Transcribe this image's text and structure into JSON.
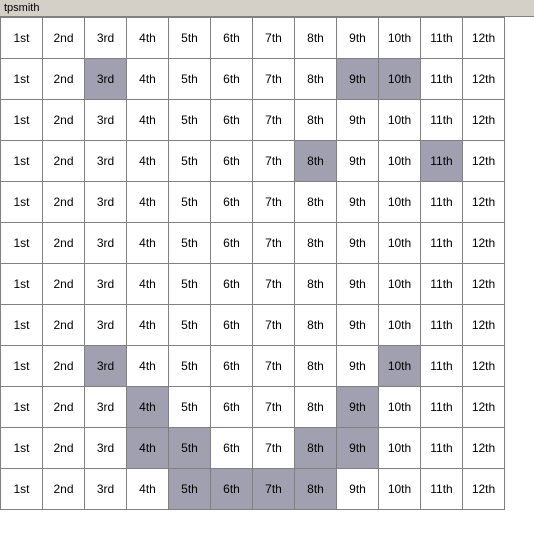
{
  "title": "tpsmith",
  "columns": [
    "1st",
    "2nd",
    "3rd",
    "4th",
    "5th",
    "6th",
    "7th",
    "8th",
    "9th",
    "10th",
    "11th",
    "12th"
  ],
  "rows": [
    {
      "cells": [
        {
          "text": "1st",
          "hl": false
        },
        {
          "text": "2nd",
          "hl": false
        },
        {
          "text": "3rd",
          "hl": false
        },
        {
          "text": "4th",
          "hl": false
        },
        {
          "text": "5th",
          "hl": false
        },
        {
          "text": "6th",
          "hl": false
        },
        {
          "text": "7th",
          "hl": false
        },
        {
          "text": "8th",
          "hl": false
        },
        {
          "text": "9th",
          "hl": false
        },
        {
          "text": "10th",
          "hl": false
        },
        {
          "text": "11th",
          "hl": false
        },
        {
          "text": "12th",
          "hl": false
        }
      ]
    },
    {
      "cells": [
        {
          "text": "1st",
          "hl": false
        },
        {
          "text": "2nd",
          "hl": false
        },
        {
          "text": "3rd",
          "hl": true
        },
        {
          "text": "4th",
          "hl": false
        },
        {
          "text": "5th",
          "hl": false
        },
        {
          "text": "6th",
          "hl": false
        },
        {
          "text": "7th",
          "hl": false
        },
        {
          "text": "8th",
          "hl": false
        },
        {
          "text": "9th",
          "hl": true
        },
        {
          "text": "10th",
          "hl": true
        },
        {
          "text": "11th",
          "hl": false
        },
        {
          "text": "12th",
          "hl": false
        }
      ]
    },
    {
      "cells": [
        {
          "text": "1st",
          "hl": false
        },
        {
          "text": "2nd",
          "hl": false
        },
        {
          "text": "3rd",
          "hl": false
        },
        {
          "text": "4th",
          "hl": false
        },
        {
          "text": "5th",
          "hl": false
        },
        {
          "text": "6th",
          "hl": false
        },
        {
          "text": "7th",
          "hl": false
        },
        {
          "text": "8th",
          "hl": false
        },
        {
          "text": "9th",
          "hl": false
        },
        {
          "text": "10th",
          "hl": false
        },
        {
          "text": "11th",
          "hl": false
        },
        {
          "text": "12th",
          "hl": false
        }
      ]
    },
    {
      "cells": [
        {
          "text": "1st",
          "hl": false
        },
        {
          "text": "2nd",
          "hl": false
        },
        {
          "text": "3rd",
          "hl": false
        },
        {
          "text": "4th",
          "hl": false
        },
        {
          "text": "5th",
          "hl": false
        },
        {
          "text": "6th",
          "hl": false
        },
        {
          "text": "7th",
          "hl": false
        },
        {
          "text": "8th",
          "hl": true
        },
        {
          "text": "9th",
          "hl": false
        },
        {
          "text": "10th",
          "hl": false
        },
        {
          "text": "11th",
          "hl": true
        },
        {
          "text": "12th",
          "hl": false
        }
      ]
    },
    {
      "cells": [
        {
          "text": "1st",
          "hl": false
        },
        {
          "text": "2nd",
          "hl": false
        },
        {
          "text": "3rd",
          "hl": false
        },
        {
          "text": "4th",
          "hl": false
        },
        {
          "text": "5th",
          "hl": false
        },
        {
          "text": "6th",
          "hl": false
        },
        {
          "text": "7th",
          "hl": false
        },
        {
          "text": "8th",
          "hl": false
        },
        {
          "text": "9th",
          "hl": false
        },
        {
          "text": "10th",
          "hl": false
        },
        {
          "text": "11th",
          "hl": false
        },
        {
          "text": "12th",
          "hl": false
        }
      ]
    },
    {
      "cells": [
        {
          "text": "1st",
          "hl": false
        },
        {
          "text": "2nd",
          "hl": false
        },
        {
          "text": "3rd",
          "hl": false
        },
        {
          "text": "4th",
          "hl": false
        },
        {
          "text": "5th",
          "hl": false
        },
        {
          "text": "6th",
          "hl": false
        },
        {
          "text": "7th",
          "hl": false
        },
        {
          "text": "8th",
          "hl": false
        },
        {
          "text": "9th",
          "hl": false
        },
        {
          "text": "10th",
          "hl": false
        },
        {
          "text": "11th",
          "hl": false
        },
        {
          "text": "12th",
          "hl": false
        }
      ]
    },
    {
      "cells": [
        {
          "text": "1st",
          "hl": false
        },
        {
          "text": "2nd",
          "hl": false
        },
        {
          "text": "3rd",
          "hl": false
        },
        {
          "text": "4th",
          "hl": false
        },
        {
          "text": "5th",
          "hl": false
        },
        {
          "text": "6th",
          "hl": false
        },
        {
          "text": "7th",
          "hl": false
        },
        {
          "text": "8th",
          "hl": false
        },
        {
          "text": "9th",
          "hl": false
        },
        {
          "text": "10th",
          "hl": false
        },
        {
          "text": "11th",
          "hl": false
        },
        {
          "text": "12th",
          "hl": false
        }
      ]
    },
    {
      "cells": [
        {
          "text": "1st",
          "hl": false
        },
        {
          "text": "2nd",
          "hl": false
        },
        {
          "text": "3rd",
          "hl": false
        },
        {
          "text": "4th",
          "hl": false
        },
        {
          "text": "5th",
          "hl": false
        },
        {
          "text": "6th",
          "hl": false
        },
        {
          "text": "7th",
          "hl": false
        },
        {
          "text": "8th",
          "hl": false
        },
        {
          "text": "9th",
          "hl": false
        },
        {
          "text": "10th",
          "hl": false
        },
        {
          "text": "11th",
          "hl": false
        },
        {
          "text": "12th",
          "hl": false
        }
      ]
    },
    {
      "cells": [
        {
          "text": "1st",
          "hl": false
        },
        {
          "text": "2nd",
          "hl": false
        },
        {
          "text": "3rd",
          "hl": true
        },
        {
          "text": "4th",
          "hl": false
        },
        {
          "text": "5th",
          "hl": false
        },
        {
          "text": "6th",
          "hl": false
        },
        {
          "text": "7th",
          "hl": false
        },
        {
          "text": "8th",
          "hl": false
        },
        {
          "text": "9th",
          "hl": false
        },
        {
          "text": "10th",
          "hl": true
        },
        {
          "text": "11th",
          "hl": false
        },
        {
          "text": "12th",
          "hl": false
        }
      ]
    },
    {
      "cells": [
        {
          "text": "1st",
          "hl": false
        },
        {
          "text": "2nd",
          "hl": false
        },
        {
          "text": "3rd",
          "hl": false
        },
        {
          "text": "4th",
          "hl": true
        },
        {
          "text": "5th",
          "hl": false
        },
        {
          "text": "6th",
          "hl": false
        },
        {
          "text": "7th",
          "hl": false
        },
        {
          "text": "8th",
          "hl": false
        },
        {
          "text": "9th",
          "hl": true
        },
        {
          "text": "10th",
          "hl": false
        },
        {
          "text": "11th",
          "hl": false
        },
        {
          "text": "12th",
          "hl": false
        }
      ]
    },
    {
      "cells": [
        {
          "text": "1st",
          "hl": false
        },
        {
          "text": "2nd",
          "hl": false
        },
        {
          "text": "3rd",
          "hl": false
        },
        {
          "text": "4th",
          "hl": true
        },
        {
          "text": "5th",
          "hl": true
        },
        {
          "text": "6th",
          "hl": false
        },
        {
          "text": "7th",
          "hl": false
        },
        {
          "text": "8th",
          "hl": true
        },
        {
          "text": "9th",
          "hl": true
        },
        {
          "text": "10th",
          "hl": false
        },
        {
          "text": "11th",
          "hl": false
        },
        {
          "text": "12th",
          "hl": false
        }
      ]
    },
    {
      "cells": [
        {
          "text": "1st",
          "hl": false
        },
        {
          "text": "2nd",
          "hl": false
        },
        {
          "text": "3rd",
          "hl": false
        },
        {
          "text": "4th",
          "hl": false
        },
        {
          "text": "5th",
          "hl": true
        },
        {
          "text": "6th",
          "hl": true
        },
        {
          "text": "7th",
          "hl": true
        },
        {
          "text": "8th",
          "hl": true
        },
        {
          "text": "9th",
          "hl": false
        },
        {
          "text": "10th",
          "hl": false
        },
        {
          "text": "11th",
          "hl": false
        },
        {
          "text": "12th",
          "hl": false
        }
      ]
    }
  ]
}
